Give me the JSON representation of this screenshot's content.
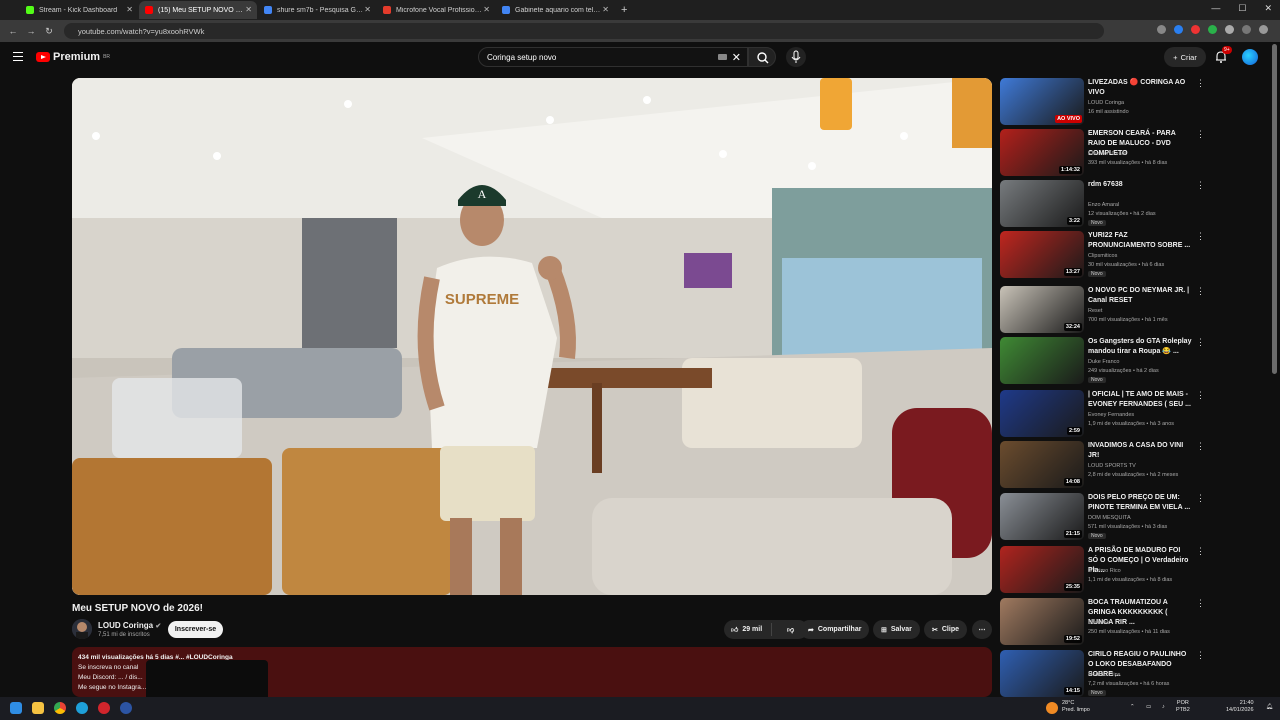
{
  "browser": {
    "tabs": [
      {
        "title": "Stream - Kick Dashboard",
        "color": "#53fc18"
      },
      {
        "title": "(15) Meu SETUP NOVO de 2026!",
        "color": "#ff0000",
        "active": true
      },
      {
        "title": "shure sm7b - Pesquisa Google",
        "color": "#4285f4"
      },
      {
        "title": "Microfone Vocal Profissional Kal",
        "color": "#e43b2b"
      },
      {
        "title": "Gabinete aquario com tela de ...",
        "color": "#4285f4"
      }
    ],
    "url": "youtube.com/watch?v=yu8xoohRVWk"
  },
  "header": {
    "logo_text": "Premium",
    "logo_sup": "BR",
    "search_value": "Coringa setup novo",
    "create_label": "Criar",
    "notif_count": "9+"
  },
  "video": {
    "title": "Meu SETUP NOVO de 2026!",
    "channel": "LOUD Coringa",
    "subscribers": "7,51 mi de inscritos",
    "subscribe_label": "Inscrever-se",
    "likes": "29 mil",
    "share_label": "Compartilhar",
    "save_label": "Salvar",
    "clip_label": "Clipe",
    "shirt_text": "SUPREME",
    "cap_text": "A"
  },
  "description": {
    "meta": "434 mil visualizações  há 5 dias  #... #LOUDCoringa",
    "line1": "Se inscreva no canal",
    "line2": "Meu Discord: ... / dis...",
    "line3": "Me segue no Instagra..."
  },
  "recommendations": [
    {
      "title": "LIVEZADAS 🔴 CORINGA AO VIVO",
      "channel": "LOUD Coringa",
      "views": "16 mil assistindo",
      "badge": "AO VIVO",
      "live": true,
      "thumb": "#3f7ad8"
    },
    {
      "title": "EMERSON CEARÁ - PARA RAIO DE MALUCO - DVD COMPLETO",
      "channel": "Emerson Ceará",
      "views": "393 mil visualizações • há 8 dias",
      "badge": "1:14:32",
      "thumb": "#b3201b"
    },
    {
      "title": "rdm 67638",
      "channel": "Enzo Amaral",
      "views": "12 visualizações • há 2 dias",
      "badge": "3:22",
      "new": "Novo",
      "thumb": "#777b7e"
    },
    {
      "title": "YURI22 FAZ PRONUNCIAMENTO SOBRE ...",
      "channel": "Clipsmiticos",
      "views": "30 mil visualizações • há 6 dias",
      "badge": "13:27",
      "new": "Novo",
      "thumb": "#c0261f"
    },
    {
      "title": "O NOVO PC DO NEYMAR JR. | Canal RESET",
      "channel": "Reset",
      "views": "700 mil visualizações • há 1 mês",
      "badge": "32:24",
      "thumb": "#c9c3b8"
    },
    {
      "title": "Os Gangsters do GTA Roleplay mandou tirar a Roupa 😂 ...",
      "channel": "Duke Franco",
      "views": "249 visualizações • há 2 dias",
      "badge": "",
      "new": "Novo",
      "thumb": "#3f8a34"
    },
    {
      "title": "| OFICIAL |  TE AMO DE MAIS - EVONEY FERNANDES ( SEU ...",
      "channel": "Evoney Fernandes",
      "views": "1,9 mi de visualizações • há 3 anos",
      "badge": "2:59",
      "thumb": "#1f3a8a"
    },
    {
      "title": "INVADIMOS A CASA DO VINI JR!",
      "channel": "LOUD SPORTS TV",
      "views": "2,8 mi de visualizações • há 2 meses",
      "badge": "14:08",
      "thumb": "#6b4c2e"
    },
    {
      "title": "DOIS PELO PREÇO DE UM: PINOTE TERMINA EM VIELA ...",
      "channel": "DOM MESQUITA",
      "views": "571 mil visualizações • há 3 dias",
      "badge": "21:15",
      "new": "Novo",
      "thumb": "#8a8f96"
    },
    {
      "title": "A PRISÃO DE MADURO FOI SÓ O COMEÇO | O Verdadeiro Pla...",
      "channel": "O Primo Rico",
      "views": "1,1 mi de visualizações • há 8 dias",
      "badge": "25:35",
      "thumb": "#b0241e"
    },
    {
      "title": "BOCA TRAUMATIZOU A GRINGA KKKKKKKKK ( NUNCA RIR ...",
      "channel": "Bocadas",
      "views": "250 mil visualizações • há 11 dias",
      "badge": "19:52",
      "thumb": "#a07a60"
    },
    {
      "title": "CIRILO REAGIU O PAULINHO O LOKO DESABAFANDO SOBRE ...",
      "channel": "Mourão Clips",
      "views": "7,2 mil visualizações • há 6 horas",
      "badge": "14:15",
      "new": "Novo",
      "thumb": "#2f5fb2"
    }
  ],
  "taskbar": {
    "weather_temp": "28°C",
    "weather_desc": "Pred. limpo",
    "lang1": "POR",
    "lang2": "PTB2",
    "time": "21:40",
    "date": "14/01/2026"
  }
}
